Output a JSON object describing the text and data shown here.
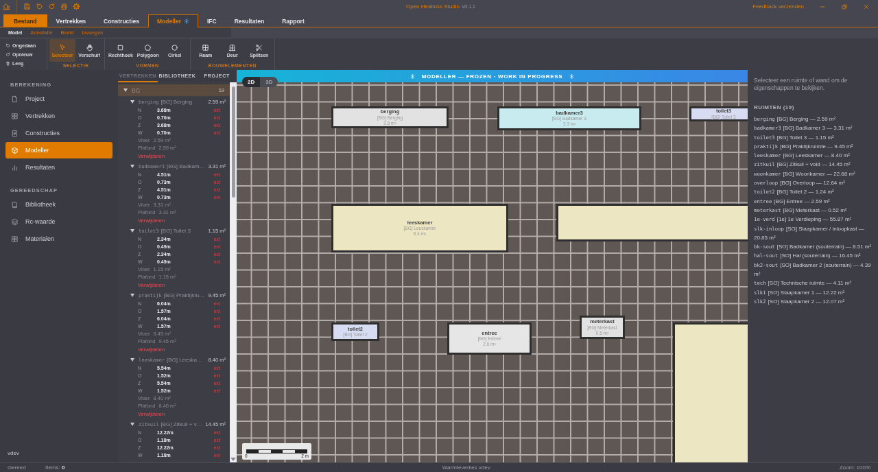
{
  "titlebar": {
    "title": "Open Heatloss Studio",
    "version": "v0.1.1",
    "feedback": "Feedback verzenden"
  },
  "main_tabs": [
    {
      "label": "Bestand",
      "kind": "file",
      "selected": false,
      "frozen": false
    },
    {
      "label": "Vertrekken",
      "kind": "tab",
      "selected": false,
      "frozen": false
    },
    {
      "label": "Constructies",
      "kind": "tab",
      "selected": false,
      "frozen": false
    },
    {
      "label": "Modeller",
      "kind": "tab",
      "selected": true,
      "frozen": true
    },
    {
      "label": "IFC",
      "kind": "tab",
      "selected": false,
      "frozen": false
    },
    {
      "label": "Resultaten",
      "kind": "tab",
      "selected": false,
      "frozen": false
    },
    {
      "label": "Rapport",
      "kind": "tab",
      "selected": false,
      "frozen": false
    }
  ],
  "sub_tabs": [
    {
      "label": "Model",
      "selected": true
    },
    {
      "label": "Annotatie",
      "selected": false
    },
    {
      "label": "Beeld",
      "selected": false
    },
    {
      "label": "Invoegen",
      "selected": false
    }
  ],
  "ribbon": {
    "history": [
      {
        "label": "Ongedaan"
      },
      {
        "label": "Opnieuw"
      },
      {
        "label": "Leeg"
      }
    ],
    "groups": [
      {
        "title": "SELECTIE",
        "tools": [
          {
            "label": "Selecteer",
            "selected": true
          },
          {
            "label": "Verschuif",
            "selected": false
          }
        ]
      },
      {
        "title": "VORMEN",
        "tools": [
          {
            "label": "Rechthoek",
            "selected": false
          },
          {
            "label": "Polygoon",
            "selected": false
          },
          {
            "label": "Cirkel",
            "selected": false
          }
        ]
      },
      {
        "title": "BOUWELEMENTEN",
        "tools": [
          {
            "label": "Raam",
            "selected": false
          },
          {
            "label": "Deur",
            "selected": false
          },
          {
            "label": "Splitsen",
            "selected": false
          }
        ]
      }
    ]
  },
  "sidebar": {
    "sections": [
      {
        "title": "BEREKENING",
        "items": [
          {
            "label": "Project",
            "selected": false
          },
          {
            "label": "Vertrekken",
            "selected": false
          },
          {
            "label": "Constructies",
            "selected": false
          },
          {
            "label": "Modeller",
            "selected": true
          },
          {
            "label": "Resultaten",
            "selected": false
          }
        ]
      },
      {
        "title": "GEREEDSCHAP",
        "items": [
          {
            "label": "Bibliotheek",
            "selected": false
          },
          {
            "label": "Rc-waarde",
            "selected": false
          },
          {
            "label": "Materialen",
            "selected": false
          }
        ]
      }
    ],
    "footer": "vdev"
  },
  "rooms_panel": {
    "tabs": [
      {
        "label": "VERTREKKEN",
        "selected": true
      },
      {
        "label": "BIBLIOTHEEK",
        "selected": false
      },
      {
        "label": "PROJECT",
        "selected": false
      }
    ],
    "group": {
      "label": "BG",
      "count": "19",
      "expanded": true
    },
    "rooms": [
      {
        "code": "berging",
        "label": "[BG] Berging",
        "area": "2.59 m²",
        "expanded": true,
        "walls": [
          {
            "side": "N",
            "length": "3.68m",
            "type": "ext"
          },
          {
            "side": "O",
            "length": "0.70m",
            "type": "ext"
          },
          {
            "side": "Z",
            "length": "3.68m",
            "type": "ext"
          },
          {
            "side": "W",
            "length": "0.70m",
            "type": "ext"
          }
        ],
        "surfaces": [
          {
            "label": "Vloer",
            "value": "2.59 m²"
          },
          {
            "label": "Plafond",
            "value": "2.59 m²"
          }
        ],
        "delete": "Verwijderen"
      },
      {
        "code": "badkamer3",
        "label": "[BG] Badkam…",
        "area": "3.31 m²",
        "expanded": true,
        "walls": [
          {
            "side": "N",
            "length": "4.51m",
            "type": "ext"
          },
          {
            "side": "O",
            "length": "0.73m",
            "type": "ext"
          },
          {
            "side": "Z",
            "length": "4.51m",
            "type": "ext"
          },
          {
            "side": "W",
            "length": "0.73m",
            "type": "ext"
          }
        ],
        "surfaces": [
          {
            "label": "Vloer",
            "value": "3.31 m²"
          },
          {
            "label": "Plafond",
            "value": "3.31 m²"
          }
        ],
        "delete": "Verwijderen"
      },
      {
        "code": "toilet3",
        "label": "[BG] Toilet 3",
        "area": "1.15 m²",
        "expanded": true,
        "walls": [
          {
            "side": "N",
            "length": "2.34m",
            "type": "ext"
          },
          {
            "side": "O",
            "length": "0.49m",
            "type": "ext"
          },
          {
            "side": "Z",
            "length": "2.34m",
            "type": "ext"
          },
          {
            "side": "W",
            "length": "0.49m",
            "type": "ext"
          }
        ],
        "surfaces": [
          {
            "label": "Vloer",
            "value": "1.15 m²"
          },
          {
            "label": "Plafond",
            "value": "1.15 m²"
          }
        ],
        "delete": "Verwijderen"
      },
      {
        "code": "praktijk",
        "label": "[BG] Praktijkru…",
        "area": "9.45 m²",
        "expanded": true,
        "walls": [
          {
            "side": "N",
            "length": "6.04m",
            "type": "ext"
          },
          {
            "side": "O",
            "length": "1.57m",
            "type": "ext"
          },
          {
            "side": "Z",
            "length": "6.04m",
            "type": "ext"
          },
          {
            "side": "W",
            "length": "1.57m",
            "type": "ext"
          }
        ],
        "surfaces": [
          {
            "label": "Vloer",
            "value": "9.45 m²"
          },
          {
            "label": "Plafond",
            "value": "9.45 m²"
          }
        ],
        "delete": "Verwijderen"
      },
      {
        "code": "leeskamer",
        "label": "[BG] Leeska…",
        "area": "8.40 m²",
        "expanded": true,
        "walls": [
          {
            "side": "N",
            "length": "5.54m",
            "type": "ext"
          },
          {
            "side": "O",
            "length": "1.52m",
            "type": "ext"
          },
          {
            "side": "Z",
            "length": "5.54m",
            "type": "ext"
          },
          {
            "side": "W",
            "length": "1.52m",
            "type": "ext"
          }
        ],
        "surfaces": [
          {
            "label": "Vloer",
            "value": "8.40 m²"
          },
          {
            "label": "Plafond",
            "value": "8.40 m²"
          }
        ],
        "delete": "Verwijderen"
      },
      {
        "code": "zitkuil",
        "label": "[BG] Zitkuil + v…",
        "area": "14.45 m²",
        "expanded": true,
        "walls": [
          {
            "side": "N",
            "length": "12.22m",
            "type": "ext"
          },
          {
            "side": "O",
            "length": "1.18m",
            "type": "ext"
          },
          {
            "side": "Z",
            "length": "12.22m",
            "type": "ext"
          },
          {
            "side": "W",
            "length": "1.18m",
            "type": "ext"
          }
        ]
      }
    ]
  },
  "canvas": {
    "banner": "MODELLER — FROZEN · WORK IN PROGRESS",
    "view_modes": [
      {
        "label": "2D",
        "selected": true
      },
      {
        "label": "3D",
        "selected": false
      }
    ],
    "rooms": [
      {
        "name": "berging",
        "label": "[BG] Berging",
        "area": "2.6 m²",
        "color": "#e2e2e2"
      },
      {
        "name": "badkamer3",
        "label": "[BG] Badkamer 3",
        "area": "3.3 m²",
        "color": "#c8ebf0"
      },
      {
        "name": "toilet3",
        "label": "[BG] Toilet 3",
        "color": "#d8dcf2"
      },
      {
        "name": "leeskamer",
        "label": "[BG] Leeskamer",
        "area": "8.4 m²",
        "color": "#ede6c2"
      },
      {
        "color": "#ede6c2"
      },
      {
        "name": "toilet2",
        "label": "[BG] Toilet 2",
        "color": "#d8dcf2"
      },
      {
        "name": "entree",
        "label": "[BG] Entree",
        "area": "2.6 m²",
        "color": "#e6e6e6"
      },
      {
        "name": "meterkast",
        "label": "[BG] Meterkast",
        "area": "0.5 m²",
        "color": "#e2e2e2"
      },
      {
        "color": "#ede6c2"
      }
    ],
    "scale": {
      "start": "0",
      "end": "2 m"
    }
  },
  "properties": {
    "hint": "Selecteer een ruimte of wand om de eigenschappen te bekijken.",
    "heading": "RUIMTEN (19)",
    "spaces": [
      {
        "code": "berging",
        "text": "[BG] Berging — 2.59 m²"
      },
      {
        "code": "badkamer3",
        "text": "[BG] Badkamer 3 — 3.31 m²"
      },
      {
        "code": "toilet3",
        "text": "[BG] Toilet 3 — 1.15 m²"
      },
      {
        "code": "praktijk",
        "text": "[BG] Praktijkruimte — 9.45 m²"
      },
      {
        "code": "leeskamer",
        "text": "[BG] Leeskamer — 8.40 m²"
      },
      {
        "code": "zitkuil",
        "text": "[BG] Zitkuil + void — 14.45 m²"
      },
      {
        "code": "woonkamer",
        "text": "[BG] Woonkamer — 22.68 m²"
      },
      {
        "code": "overloop",
        "text": "[BG] Overloop — 12.64 m²"
      },
      {
        "code": "toilet2",
        "text": "[BG] Toilet 2 — 1.24 m²"
      },
      {
        "code": "entree",
        "text": "[BG] Entree — 2.59 m²"
      },
      {
        "code": "meterkast",
        "text": "[BG] Meterkast — 0.52 m²"
      },
      {
        "code": "1e-verd",
        "text": "[1e] 1e Verdieping — 55.87 m²"
      },
      {
        "code": "slk-inloop",
        "text": "[SO] Slaapkamer / inloopkast — 20.85 m²"
      },
      {
        "code": "bk-sout",
        "text": "[SO] Badkamer (souterrain) — 8.51 m²"
      },
      {
        "code": "hal-sout",
        "text": "[SO] Hal (souterrain) — 16.45 m²"
      },
      {
        "code": "bk2-sout",
        "text": "[SO] Badkamer 2 (souterrain) — 4.39 m²"
      },
      {
        "code": "tech",
        "text": "[SO] Technische ruimte — 4.11 m²"
      },
      {
        "code": "slk1",
        "text": "[SO] Slaapkamer 1 — 12.22 m²"
      },
      {
        "code": "slk2",
        "text": "[SO] Slaapkamer 2 — 12.07 m²"
      }
    ]
  },
  "status_bar": {
    "state": "Gereed",
    "items": "Items: **0**",
    "center": "Warmteverlies vdev",
    "zoom": "Zoom: 100%"
  }
}
